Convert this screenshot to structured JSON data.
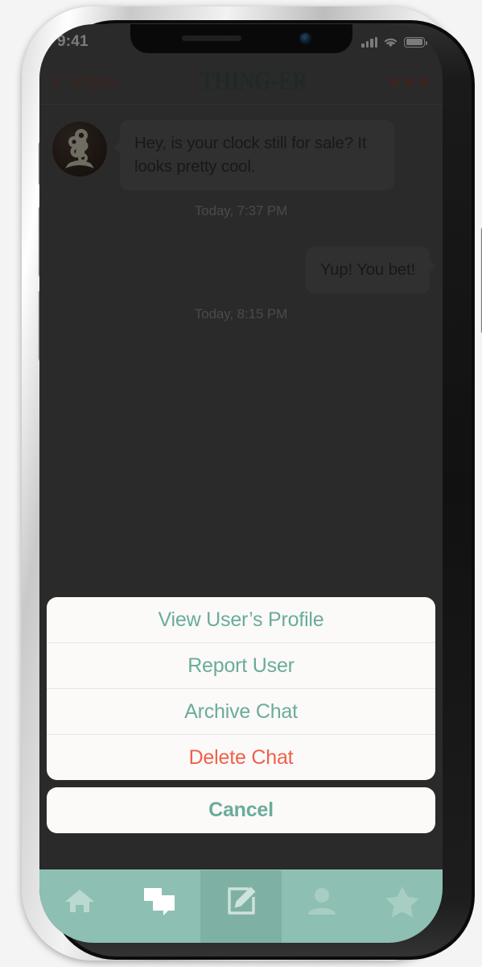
{
  "status_bar": {
    "time": "9:41",
    "signal_icon": "cellular-bars-icon",
    "wifi_icon": "wifi-icon",
    "battery_icon": "battery-full-icon"
  },
  "navbar": {
    "back_label": "Inbox",
    "back_icon": "chevron-left-icon",
    "title": "THING-ER",
    "more_icon": "more-dots-icon",
    "title_color": "#2b3b34",
    "back_color": "#5b332c"
  },
  "chat": {
    "avatar_name": "user-avatar",
    "messages": [
      {
        "id": "msg-1",
        "direction": "incoming",
        "text": "Hey, is your clock still for sale? It looks pretty cool.",
        "timestamp": "Today, 7:37 PM"
      },
      {
        "id": "msg-2",
        "direction": "outgoing",
        "text": "Yup! You bet!",
        "timestamp": "Today, 8:15 PM"
      }
    ],
    "bubble_color": "#474747",
    "background_color": "#3c3c3c",
    "timestamp_color": "#777777"
  },
  "action_sheet": {
    "items": [
      {
        "id": "view-profile",
        "label": "View User’s Profile",
        "style": "default"
      },
      {
        "id": "report-user",
        "label": "Report User",
        "style": "default"
      },
      {
        "id": "archive-chat",
        "label": "Archive Chat",
        "style": "default"
      },
      {
        "id": "delete-chat",
        "label": "Delete Chat",
        "style": "destructive"
      }
    ],
    "cancel_label": "Cancel",
    "tint_color": "#6aac9b",
    "destructive_color": "#f0604a",
    "sheet_background": "#fbfaf8"
  },
  "tab_bar": {
    "background_color": "#8dbfb3",
    "selected_background_color": "#7fb0a4",
    "tabs": [
      {
        "id": "tab-home",
        "icon": "home-icon",
        "selected": false,
        "active_icon": false
      },
      {
        "id": "tab-chats",
        "icon": "chat-bubbles-icon",
        "selected": false,
        "active_icon": true
      },
      {
        "id": "tab-compose",
        "icon": "compose-icon",
        "selected": true,
        "active_icon": false
      },
      {
        "id": "tab-profile",
        "icon": "person-icon",
        "selected": false,
        "active_icon": false
      },
      {
        "id": "tab-favorites",
        "icon": "star-icon",
        "selected": false,
        "active_icon": false
      }
    ]
  },
  "device": {
    "buttons": [
      "silent-switch",
      "volume-up-button",
      "volume-down-button",
      "power-button"
    ],
    "notch": [
      "earpiece-speaker",
      "front-camera"
    ]
  }
}
